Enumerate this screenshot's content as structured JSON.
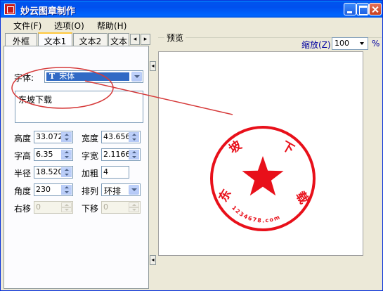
{
  "window": {
    "title": "妙云图章制作"
  },
  "menu": {
    "items": [
      "文件(F)",
      "选项(O)",
      "帮助(H)"
    ]
  },
  "tabs": {
    "items": [
      "外框",
      "文本1",
      "文本2",
      "文本"
    ],
    "active": "文本1"
  },
  "form": {
    "font_label": "字体:",
    "font_value": "宋体",
    "font_icon": "TrueType-T-icon",
    "text_value": "东坡下载",
    "height_label": "高度",
    "height_value": "33.072",
    "width_label": "宽度",
    "width_value": "43.656",
    "char_height_label": "字高",
    "char_height_value": "6.35",
    "char_width_label": "字宽",
    "char_width_value": "2.1166",
    "radius_label": "半径",
    "radius_value": "18.520",
    "bold_label": "加粗",
    "bold_value": "4",
    "angle_label": "角度",
    "angle_value": "230",
    "arrange_label": "排列",
    "arrange_value": "环排",
    "right_shift_label": "右移",
    "right_shift_value": "0",
    "down_shift_label": "下移",
    "down_shift_value": "0"
  },
  "preview": {
    "label": "预览",
    "zoom_label": "缩放(Z)",
    "zoom_value": "100",
    "zoom_unit": "%"
  },
  "stamp": {
    "color": "#e8101a",
    "top_chars": [
      "东",
      "坡",
      "下",
      "载"
    ],
    "bottom_text": "1234678.com",
    "center_icon": "star-icon"
  },
  "annotation": {
    "color": "#d63a3a"
  }
}
